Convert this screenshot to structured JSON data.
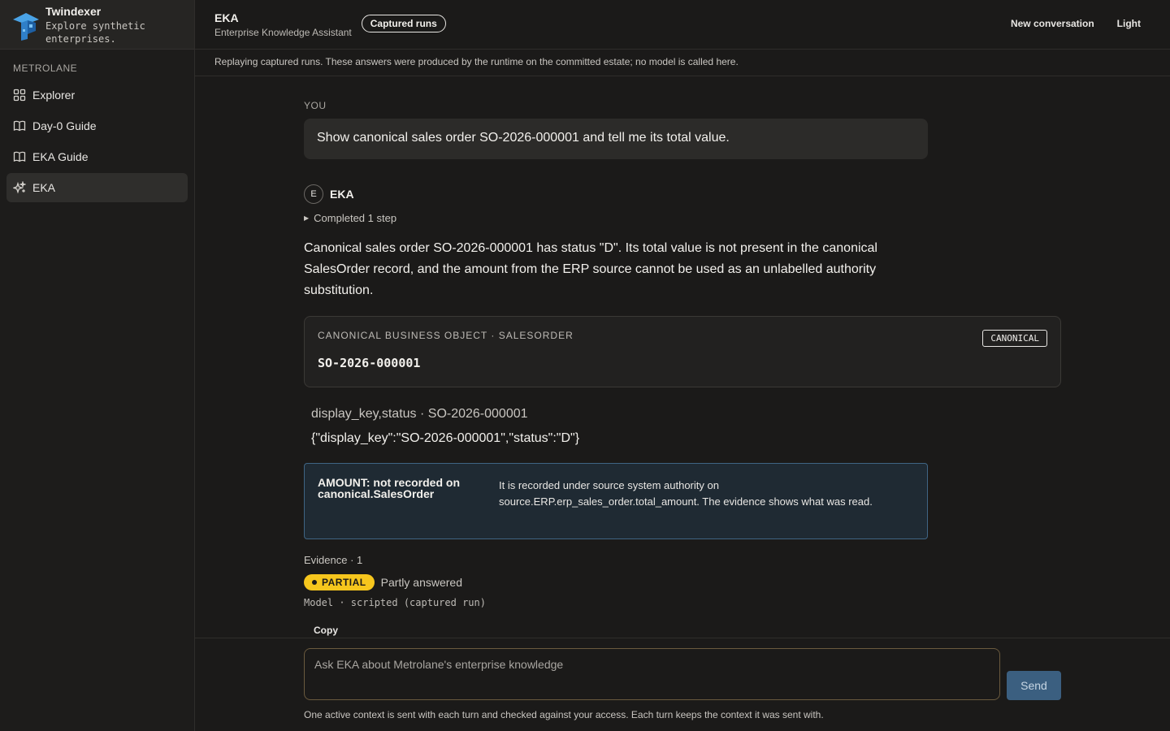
{
  "sidebar": {
    "brand_name": "Twindexer",
    "brand_tagline": "Explore synthetic enterprises.",
    "section": "METROLANE",
    "items": [
      {
        "label": "Explorer",
        "icon": "grid-icon"
      },
      {
        "label": "Day-0 Guide",
        "icon": "book-icon"
      },
      {
        "label": "EKA Guide",
        "icon": "book-icon"
      },
      {
        "label": "EKA",
        "icon": "sparkle-icon",
        "active": true
      }
    ]
  },
  "header": {
    "title": "EKA",
    "subtitle": "Enterprise Knowledge Assistant",
    "pill": "Captured runs",
    "new_conversation": "New conversation",
    "theme": "Light"
  },
  "notice": "Replaying captured runs. These answers were produced by the runtime on the committed estate; no model is called here.",
  "conversation": {
    "you_label": "YOU",
    "user_message": "Show canonical sales order SO-2026-000001 and tell me its total value.",
    "bot_avatar": "E",
    "bot_name": "EKA",
    "steps": "Completed 1 step",
    "answer": "Canonical sales order SO-2026-000001 has status \"D\". Its total value is not present in the canonical SalesOrder record, and the amount from the ERP source cannot be used as an unlabelled authority substitution.",
    "object_card": {
      "label": "CANONICAL BUSINESS OBJECT · SALESORDER",
      "id": "SO-2026-000001",
      "badge": "CANONICAL"
    },
    "field_key": "display_key,status · SO-2026-000001",
    "field_value": "{\"display_key\":\"SO-2026-000001\",\"status\":\"D\"}",
    "amount": {
      "label": "AMOUNT: not recorded on canonical.SalesOrder",
      "text": "It is recorded under source system authority on source.ERP.erp_sales_order.total_amount. The evidence shows what was read."
    },
    "evidence": "Evidence · 1",
    "status_badge": "PARTIAL",
    "status_text": "Partly answered",
    "model_line": "Model · scripted (captured run)",
    "copy": "Copy"
  },
  "composer": {
    "placeholder": "Ask EKA about Metrolane's enterprise knowledge",
    "send": "Send",
    "footnote": "One active context is sent with each turn and checked against your access. Each turn keeps the context it was sent with."
  },
  "colors": {
    "background": "#1b1a19",
    "accent_partial": "#f6c61d",
    "send_button": "#3b5f80",
    "amount_border": "#3f6584"
  }
}
